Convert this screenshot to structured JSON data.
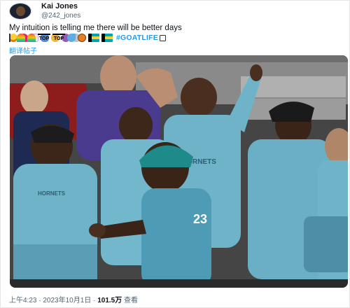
{
  "tweet": {
    "display_name": "Kai Jones",
    "handle": "@242_jones",
    "text": "My intuition is telling me there will be better days",
    "hashtag": "#GOATLIFE",
    "translate_link": "翻译帖子",
    "emoji_icons": [
      "heart-eyes-icon",
      "heart-icon",
      "unicorn-icon",
      "butterfly-icon",
      "medal-icon",
      "peace-icon",
      "ufo-icon",
      "running-person-icon",
      "rainbow-icon",
      "rainbow-icon",
      "top-icon",
      "top-icon",
      "splash-icon",
      "basketball-icon",
      "bahamas-flag-icon",
      "bahamas-flag-icon",
      "square-icon"
    ],
    "meta": {
      "time": "上午4:23",
      "date": "2023年10月1日",
      "views": "101.5万",
      "views_label": "查看",
      "separator": "·"
    }
  },
  "photo": {
    "jersey_text": "HORNETS",
    "colors": {
      "jersey": "#6fb3c9",
      "jersey_dark": "#2c5f73",
      "background": "#4a4a4a",
      "skin": "#5a3a28",
      "court_wall": "#9a9a9a",
      "seat_red": "#8d1c1c"
    }
  }
}
